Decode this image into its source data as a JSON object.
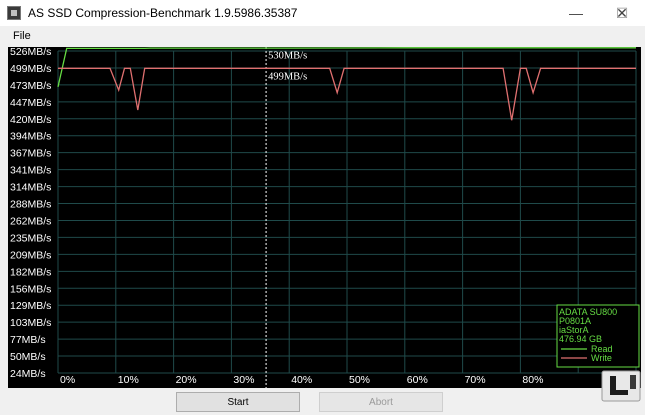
{
  "window": {
    "title": "AS SSD Compression-Benchmark 1.9.5986.35387",
    "minimize_glyph": "—",
    "maximize_glyph": "☐",
    "close_glyph": "✕"
  },
  "menu": {
    "items": [
      {
        "label": "File"
      }
    ]
  },
  "chart_data": {
    "type": "line",
    "x_ticks": [
      "0%",
      "10%",
      "20%",
      "30%",
      "40%",
      "50%",
      "60%",
      "70%",
      "80%"
    ],
    "y_ticks": [
      "526MB/s",
      "499MB/s",
      "473MB/s",
      "447MB/s",
      "420MB/s",
      "394MB/s",
      "367MB/s",
      "341MB/s",
      "314MB/s",
      "288MB/s",
      "262MB/s",
      "235MB/s",
      "209MB/s",
      "182MB/s",
      "156MB/s",
      "129MB/s",
      "103MB/s",
      "77MB/s",
      "50MB/s",
      "24MB/s"
    ],
    "ylim": [
      24,
      526
    ],
    "xlim": [
      0,
      100
    ],
    "grid": true,
    "cursor_x": 36,
    "annotations": [
      {
        "text": "530MB/s"
      },
      {
        "text": "499MB/s"
      }
    ],
    "series": [
      {
        "name": "Read",
        "color": "#66dd44",
        "points": [
          [
            0,
            470
          ],
          [
            1.5,
            530
          ],
          [
            15,
            530
          ],
          [
            16,
            530.5
          ],
          [
            40,
            530.5
          ],
          [
            60,
            531
          ],
          [
            80,
            531
          ],
          [
            100,
            531
          ]
        ]
      },
      {
        "name": "Write",
        "color": "#e07070",
        "points": [
          [
            0,
            499
          ],
          [
            9,
            499
          ],
          [
            10.5,
            465
          ],
          [
            11.5,
            499
          ],
          [
            12.5,
            499
          ],
          [
            13.8,
            434
          ],
          [
            15,
            499
          ],
          [
            47,
            499
          ],
          [
            48.3,
            461
          ],
          [
            49.5,
            499
          ],
          [
            77,
            499
          ],
          [
            78.5,
            418
          ],
          [
            80,
            499
          ],
          [
            81,
            499
          ],
          [
            82.2,
            461
          ],
          [
            83.5,
            499
          ],
          [
            100,
            499
          ]
        ]
      }
    ],
    "legend": {
      "position": "bottom-right",
      "lines": [
        "ADATA SU800",
        "P0801A",
        "iaStorA",
        "476.94 GB"
      ],
      "entries": [
        {
          "label": "Read",
          "color": "#66dd44"
        },
        {
          "label": "Write",
          "color": "#e07070"
        }
      ]
    }
  },
  "buttons": {
    "start": "Start",
    "abort": "Abort"
  }
}
